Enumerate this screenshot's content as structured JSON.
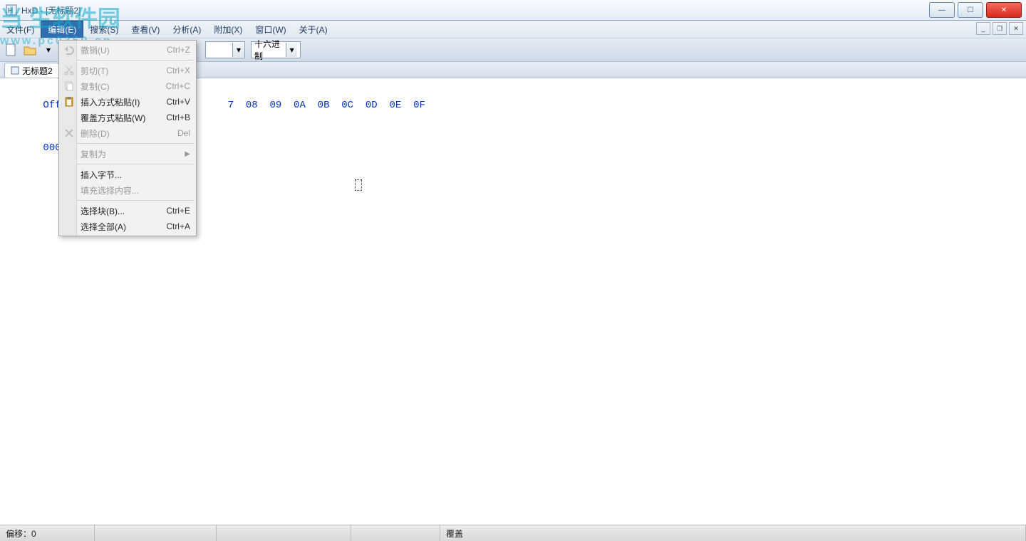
{
  "title": "HxD - [无标题2]",
  "watermark": {
    "big": "当 生软件园",
    "url": "www.pc0359.cn"
  },
  "menu": {
    "items": [
      {
        "label": "文件(F)"
      },
      {
        "label": "编辑(E)",
        "active": true
      },
      {
        "label": "搜索(S)"
      },
      {
        "label": "查看(V)"
      },
      {
        "label": "分析(A)"
      },
      {
        "label": "附加(X)"
      },
      {
        "label": "窗口(W)"
      },
      {
        "label": "关于(A)"
      }
    ]
  },
  "toolbar": {
    "radix_label": "十六进制"
  },
  "tab": {
    "label": "无标题2"
  },
  "hex": {
    "header_prefix": "Offset(h",
    "header_cols": "7  08  09  0A  0B  0C  0D  0E  0F",
    "row0": "0000000"
  },
  "edit_menu": {
    "undo": {
      "label": "撤销(U)",
      "shortcut": "Ctrl+Z"
    },
    "cut": {
      "label": "剪切(T)",
      "shortcut": "Ctrl+X"
    },
    "copy": {
      "label": "复制(C)",
      "shortcut": "Ctrl+C"
    },
    "paste_insert": {
      "label": "插入方式粘贴(I)",
      "shortcut": "Ctrl+V"
    },
    "paste_overwrite": {
      "label": "覆盖方式粘贴(W)",
      "shortcut": "Ctrl+B"
    },
    "delete": {
      "label": "删除(D)",
      "shortcut": "Del"
    },
    "copy_as": {
      "label": "复制为"
    },
    "insert_bytes": {
      "label": "插入字节..."
    },
    "fill_selection": {
      "label": "填充选择内容..."
    },
    "select_block": {
      "label": "选择块(B)...",
      "shortcut": "Ctrl+E"
    },
    "select_all": {
      "label": "选择全部(A)",
      "shortcut": "Ctrl+A"
    }
  },
  "status": {
    "offset": "偏移：0",
    "mode": "覆盖"
  }
}
